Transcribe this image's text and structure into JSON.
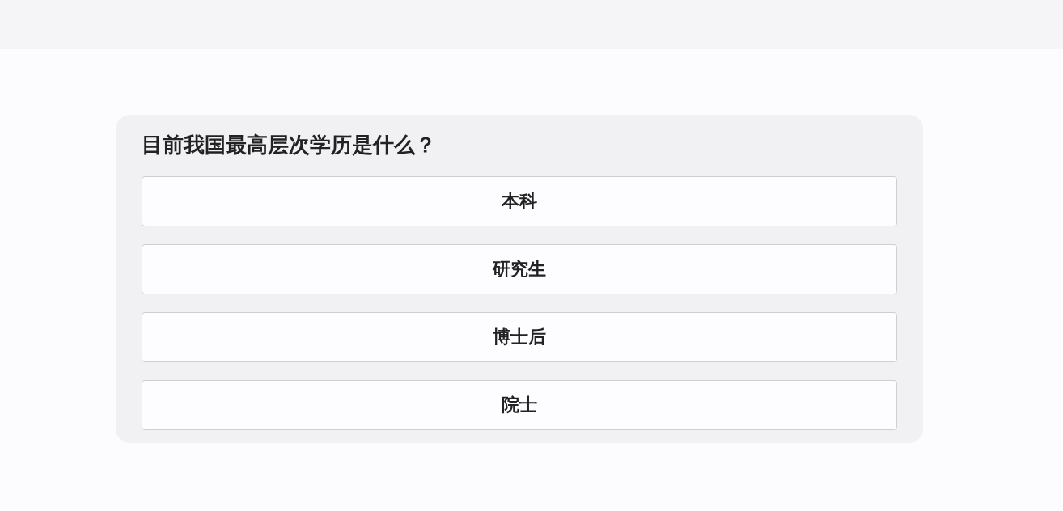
{
  "quiz": {
    "question": "目前我国最高层次学历是什么？",
    "options": [
      "本科",
      "研究生",
      "博士后",
      "院士"
    ]
  }
}
